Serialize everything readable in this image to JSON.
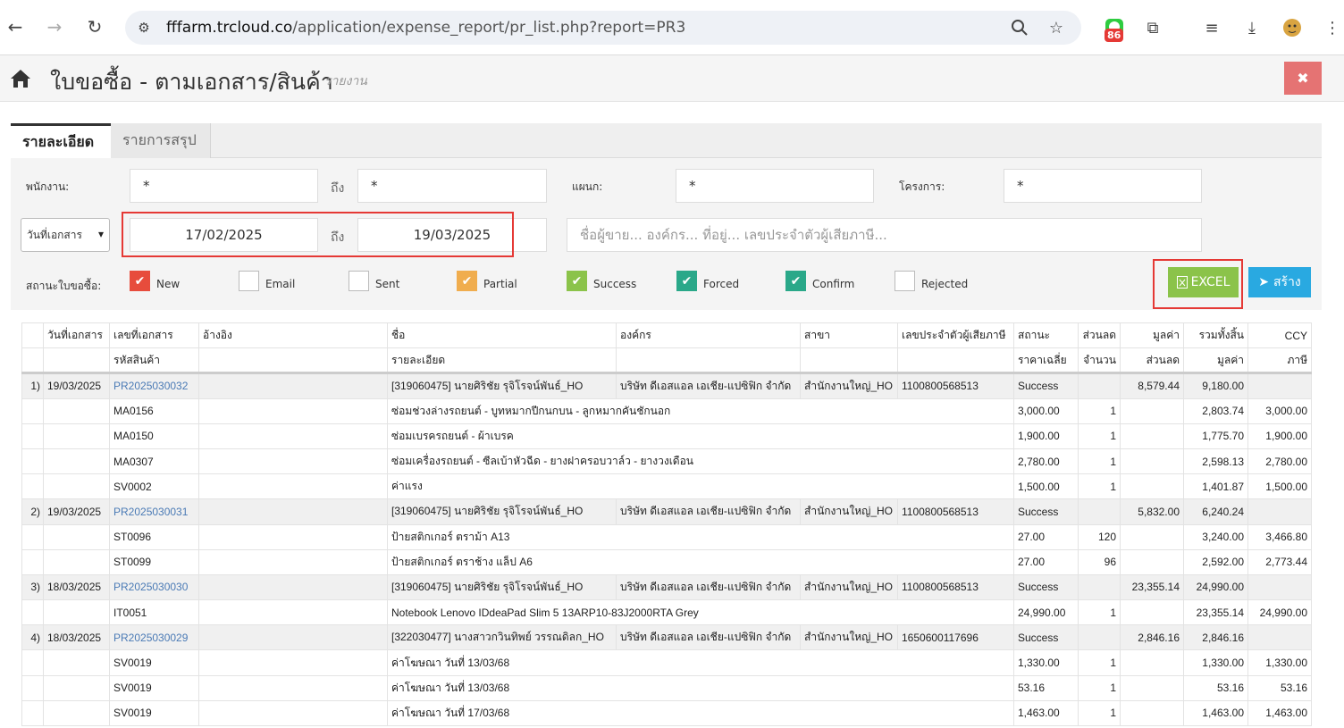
{
  "browser": {
    "url_host": "fffarm.trcloud.co",
    "url_path": "/application/expense_report/pr_list.php?report=PR3",
    "ext_badge": "86"
  },
  "header": {
    "title": "ใบขอซื้อ - ตามเอกสาร/สินค้า",
    "subtitle": "รายงาน",
    "close_label": "✖"
  },
  "tabs": [
    {
      "label": "รายละเอียด"
    },
    {
      "label": "รายการสรุป"
    }
  ],
  "filters": {
    "employee_label": "พนักงาน:",
    "employee_from": "*",
    "to_label": "ถึง",
    "employee_to": "*",
    "department_label": "แผนก:",
    "department_value": "*",
    "project_label": "โครงการ:",
    "project_value": "*",
    "date_type": "วันที่เอกสาร",
    "date_from": "17/02/2025",
    "date_to": "19/03/2025",
    "search_placeholder": "ชื่อผู้ขาย... องค์กร... ที่อยู่... เลขประจำตัวผู้เสียภาษี...",
    "status_label": "สถานะใบขอซื้อ:",
    "statuses": [
      {
        "label": "New",
        "checked": true,
        "color": "#e74c3c"
      },
      {
        "label": "Email",
        "checked": false,
        "color": "#ffffff"
      },
      {
        "label": "Sent",
        "checked": false,
        "color": "#ffffff"
      },
      {
        "label": "Partial",
        "checked": true,
        "color": "#f0ad4e"
      },
      {
        "label": "Success",
        "checked": true,
        "color": "#8bc34a"
      },
      {
        "label": "Forced",
        "checked": true,
        "color": "#2aa889"
      },
      {
        "label": "Confirm",
        "checked": true,
        "color": "#2aa889"
      },
      {
        "label": "Rejected",
        "checked": false,
        "color": "#ffffff"
      }
    ]
  },
  "buttons": {
    "excel": "EXCEL",
    "create": "สร้าง"
  },
  "table": {
    "header1": [
      "",
      "วันที่เอกสาร",
      "เลขที่เอกสาร",
      "อ้างอิง",
      "ชื่อ",
      "องค์กร",
      "สาขา",
      "เลขประจำตัวผู้เสียภาษี",
      "สถานะ",
      "ส่วนลด",
      "มูลค่า",
      "รวมทั้งสิ้น",
      "CCY"
    ],
    "header2": [
      "",
      "",
      "รหัสสินค้า",
      "",
      "รายละเอียด",
      "",
      "",
      "",
      "ราคาเฉลี่ย",
      "จำนวน",
      "ส่วนลด",
      "มูลค่า",
      "ภาษี"
    ],
    "rows": [
      {
        "type": "main",
        "cells": [
          "1)",
          "19/03/2025",
          "PR2025030032",
          "",
          "[319060475] นายศิริชัย รุจิโรจน์พันธ์_HO",
          "บริษัท ดีเอสแอล เอเชีย-แปซิฟิก จำกัด",
          "สำนักงานใหญ่_HO",
          "1100800568513",
          "Success",
          "",
          "8,579.44",
          "9,180.00",
          ""
        ]
      },
      {
        "type": "item",
        "cells": [
          "MA0156",
          "ซ่อมช่วงล่างรถยนต์ - บูทหมากปีกนกบน - ลูกหมากคันชักนอก",
          "3,000.00",
          "1",
          "",
          "2,803.74",
          "3,000.00"
        ]
      },
      {
        "type": "item",
        "cells": [
          "MA0150",
          "ซ่อมเบรครถยนต์ - ผ้าเบรค",
          "1,900.00",
          "1",
          "",
          "1,775.70",
          "1,900.00"
        ]
      },
      {
        "type": "item",
        "cells": [
          "MA0307",
          "ซ่อมเครื่องรถยนต์ - ซีลเบ้าหัวฉีด - ยางฝาครอบวาล์ว - ยางวงเดือน",
          "2,780.00",
          "1",
          "",
          "2,598.13",
          "2,780.00"
        ]
      },
      {
        "type": "item",
        "cells": [
          "SV0002",
          "ค่าแรง",
          "1,500.00",
          "1",
          "",
          "1,401.87",
          "1,500.00"
        ]
      },
      {
        "type": "main",
        "cells": [
          "2)",
          "19/03/2025",
          "PR2025030031",
          "",
          "[319060475] นายศิริชัย รุจิโรจน์พันธ์_HO",
          "บริษัท ดีเอสแอล เอเชีย-แปซิฟิก จำกัด",
          "สำนักงานใหญ่_HO",
          "1100800568513",
          "Success",
          "",
          "5,832.00",
          "6,240.24",
          ""
        ]
      },
      {
        "type": "item",
        "cells": [
          "ST0096",
          "ป้ายสติกเกอร์ ตราม้า A13",
          "27.00",
          "120",
          "",
          "3,240.00",
          "3,466.80"
        ]
      },
      {
        "type": "item",
        "cells": [
          "ST0099",
          "ป้ายสติกเกอร์ ตราช้าง แล็ป A6",
          "27.00",
          "96",
          "",
          "2,592.00",
          "2,773.44"
        ]
      },
      {
        "type": "main",
        "cells": [
          "3)",
          "18/03/2025",
          "PR2025030030",
          "",
          "[319060475] นายศิริชัย รุจิโรจน์พันธ์_HO",
          "บริษัท ดีเอสแอล เอเชีย-แปซิฟิก จำกัด",
          "สำนักงานใหญ่_HO",
          "1100800568513",
          "Success",
          "",
          "23,355.14",
          "24,990.00",
          ""
        ]
      },
      {
        "type": "item",
        "cells": [
          "IT0051",
          "Notebook Lenovo IDdeaPad Slim 5 13ARP10-83J2000RTA Grey",
          "24,990.00",
          "1",
          "",
          "23,355.14",
          "24,990.00"
        ]
      },
      {
        "type": "main",
        "cells": [
          "4)",
          "18/03/2025",
          "PR2025030029",
          "",
          "[322030477] นางสาวกวินทิพย์ วรรณดิลก_HO",
          "บริษัท ดีเอสแอล เอเชีย-แปซิฟิก จำกัด",
          "สำนักงานใหญ่_HO",
          "1650600117696",
          "Success",
          "",
          "2,846.16",
          "2,846.16",
          ""
        ]
      },
      {
        "type": "item",
        "cells": [
          "SV0019",
          "ค่าโฆษณา วันที่ 13/03/68",
          "1,330.00",
          "1",
          "",
          "1,330.00",
          "1,330.00"
        ]
      },
      {
        "type": "item",
        "cells": [
          "SV0019",
          "ค่าโฆษณา วันที่ 13/03/68",
          "53.16",
          "1",
          "",
          "53.16",
          "53.16"
        ]
      },
      {
        "type": "item",
        "cells": [
          "SV0019",
          "ค่าโฆษณา วันที่ 17/03/68",
          "1,463.00",
          "1",
          "",
          "1,463.00",
          "1,463.00"
        ]
      }
    ]
  }
}
